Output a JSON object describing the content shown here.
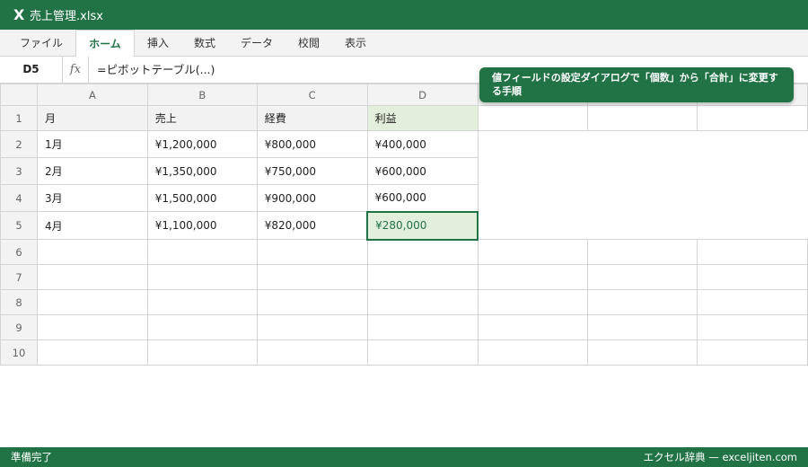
{
  "window": {
    "app_icon": "X",
    "title": "売上管理.xlsx"
  },
  "ribbon": {
    "tabs": [
      {
        "label": "ファイル",
        "active": false
      },
      {
        "label": "ホーム",
        "active": true
      },
      {
        "label": "挿入",
        "active": false
      },
      {
        "label": "数式",
        "active": false
      },
      {
        "label": "データ",
        "active": false
      },
      {
        "label": "校閲",
        "active": false
      },
      {
        "label": "表示",
        "active": false
      }
    ]
  },
  "formula_bar": {
    "name_box": "D5",
    "fx_label": "fx",
    "formula": "=ピボットテーブル(...)"
  },
  "grid": {
    "columns": [
      "A",
      "B",
      "C",
      "D",
      "",
      "",
      ""
    ],
    "rows": [
      "1",
      "2",
      "3",
      "4",
      "5",
      "6",
      "7",
      "8",
      "9",
      "10"
    ],
    "header": [
      "月",
      "売上",
      "経費",
      "利益"
    ],
    "data": [
      [
        "1月",
        "¥1,200,000",
        "¥800,000",
        "¥400,000"
      ],
      [
        "2月",
        "¥1,350,000",
        "¥750,000",
        "¥600,000"
      ],
      [
        "3月",
        "¥1,500,000",
        "¥900,000",
        "¥600,000"
      ],
      [
        "4月",
        "¥1,100,000",
        "¥820,000",
        "¥280,000"
      ]
    ],
    "selected_cell": "D5"
  },
  "callout": {
    "text": "値フィールドの設定ダイアログで「個数」から「合計」に変更する手順"
  },
  "status_bar": {
    "left": "準備完了",
    "right": "エクセル辞典 — exceljiten.com"
  },
  "colors": {
    "accent": "#217346",
    "header_fill": "#f2f2f2",
    "profit_fill": "#e2efda",
    "gridline": "#d4d4d4"
  }
}
